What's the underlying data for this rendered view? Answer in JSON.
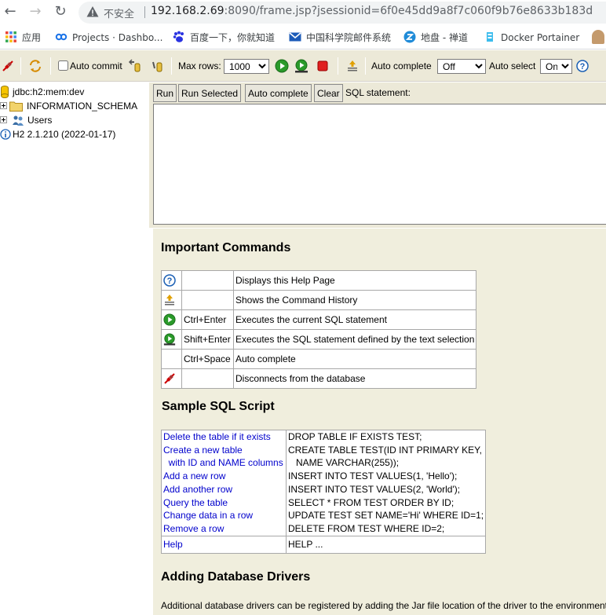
{
  "browser": {
    "insecure_label": "不安全",
    "url_host": "192.168.2.69",
    "url_rest": ":8090/frame.jsp?jsessionid=6f0e45dd9a8f7c060f9b76e8633b183d",
    "bookmarks": [
      {
        "label": "应用",
        "icon": "apps-grid-icon"
      },
      {
        "label": "Projects · Dashbo...",
        "icon": "gitlab-icon"
      },
      {
        "label": "百度一下，你就知道",
        "icon": "baidu-paw-icon"
      },
      {
        "label": "中国科学院邮件系统",
        "icon": "mail-icon"
      },
      {
        "label": "地盘 - 禅道",
        "icon": "zentao-icon"
      },
      {
        "label": "Docker Portainer",
        "icon": "portainer-icon"
      }
    ]
  },
  "toolbar": {
    "auto_commit_label": "Auto commit",
    "max_rows_label": "Max rows:",
    "max_rows_value": "1000",
    "auto_complete_label": "Auto complete",
    "auto_complete_value": "Off",
    "auto_select_label": "Auto select",
    "auto_select_value": "On",
    "help_glyph": "?"
  },
  "tree": {
    "connection": "jdbc:h2:mem:dev",
    "schema": "INFORMATION_SCHEMA",
    "users": "Users",
    "version": "H2 2.1.210 (2022-01-17)"
  },
  "query": {
    "run": "Run",
    "run_selected": "Run Selected",
    "auto_complete": "Auto complete",
    "clear": "Clear",
    "sql_label": "SQL statement:",
    "sql_value": ""
  },
  "help": {
    "important_title": "Important Commands",
    "commands": [
      {
        "icon": "help-icon",
        "key": "",
        "desc": "Displays this Help Page"
      },
      {
        "icon": "history-icon",
        "key": "",
        "desc": "Shows the Command History"
      },
      {
        "icon": "run-icon",
        "key": "Ctrl+Enter",
        "desc": "Executes the current SQL statement"
      },
      {
        "icon": "run-selected-icon",
        "key": "Shift+Enter",
        "desc": "Executes the SQL statement defined by the text selection"
      },
      {
        "icon": "",
        "key": "Ctrl+Space",
        "desc": "Auto complete"
      },
      {
        "icon": "disconnect-icon",
        "key": "",
        "desc": "Disconnects from the database"
      }
    ],
    "sample_title": "Sample SQL Script",
    "sample": [
      {
        "label": "Delete the table if it exists",
        "sql": "DROP TABLE IF EXISTS TEST;"
      },
      {
        "label": "Create a new table",
        "sql": "CREATE TABLE TEST(ID INT PRIMARY KEY,"
      },
      {
        "label": "  with ID and NAME columns",
        "sql": "   NAME VARCHAR(255));"
      },
      {
        "label": "Add a new row",
        "sql": "INSERT INTO TEST VALUES(1, 'Hello');"
      },
      {
        "label": "Add another row",
        "sql": "INSERT INTO TEST VALUES(2, 'World');"
      },
      {
        "label": "Query the table",
        "sql": "SELECT * FROM TEST ORDER BY ID;"
      },
      {
        "label": "Change data in a row",
        "sql": "UPDATE TEST SET NAME='Hi' WHERE ID=1;"
      },
      {
        "label": "Remove a row",
        "sql": "DELETE FROM TEST WHERE ID=2;"
      }
    ],
    "help_row": {
      "label": "Help",
      "sql": "HELP ..."
    },
    "drivers_title": "Adding Database Drivers",
    "drivers_text": "Additional database drivers can be registered by adding the Jar file location of the driver to the environment"
  }
}
